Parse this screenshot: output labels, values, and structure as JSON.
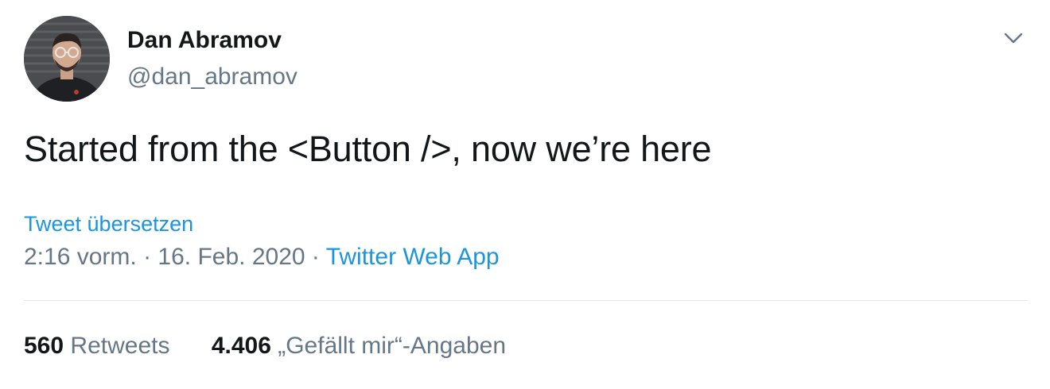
{
  "author": {
    "display_name": "Dan Abramov",
    "handle": "@dan_abramov",
    "avatar_icon": "user-avatar"
  },
  "tweet": {
    "text": "Started from the <Button />, now we’re here",
    "translate_label": "Tweet übersetzen",
    "time": "2:16 vorm.",
    "separator_1": "·",
    "date": "16. Feb. 2020",
    "separator_2": "·",
    "source": "Twitter Web App"
  },
  "stats": {
    "retweets_count": "560",
    "retweets_label": "Retweets",
    "likes_count": "4.406",
    "likes_label": "„Gefällt mir“-Angaben"
  },
  "icons": {
    "menu": "chevron-down-icon"
  },
  "colors": {
    "text_primary": "#14171a",
    "text_secondary": "#657786",
    "link": "#1b95e0",
    "divider": "#e1e8ed"
  }
}
